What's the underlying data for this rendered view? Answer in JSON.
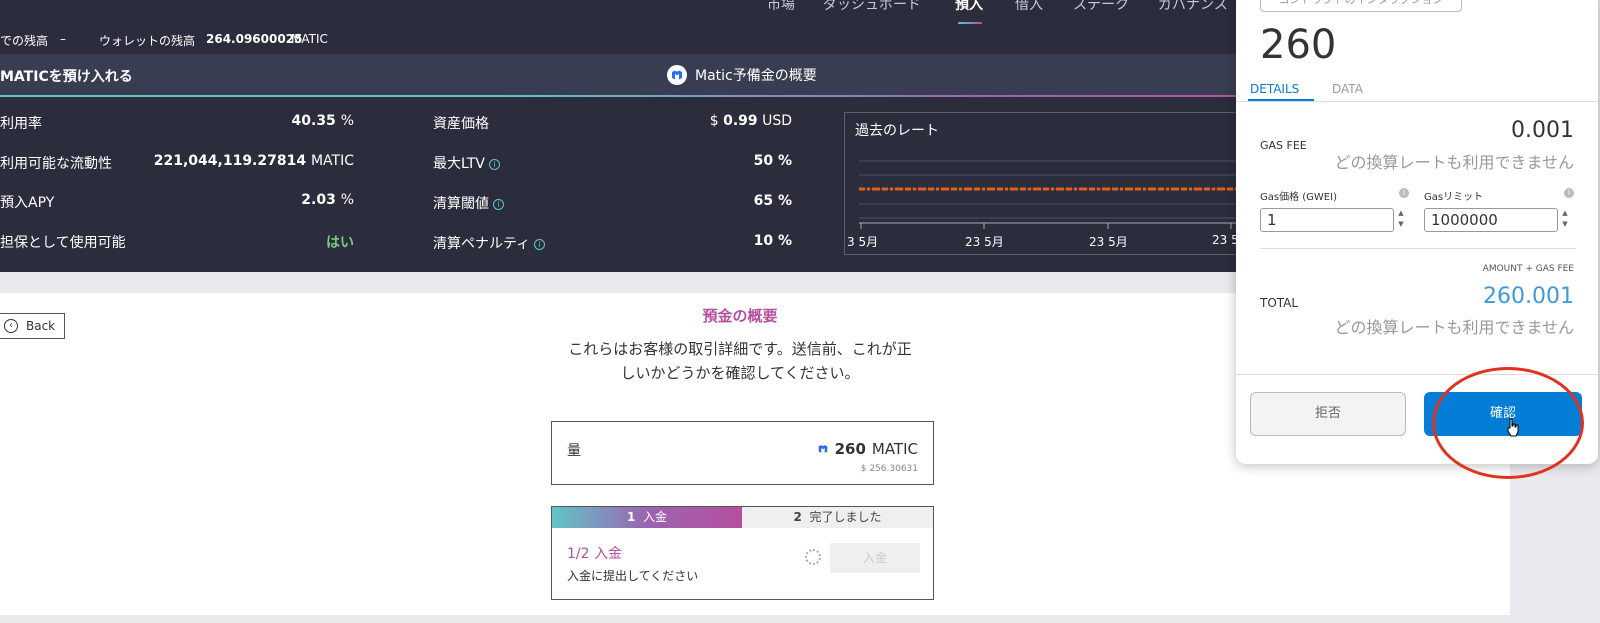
{
  "nav": {
    "items": [
      "市場",
      "ダッシュボード",
      "預入",
      "借入",
      "ステーク",
      "ガバナンス"
    ]
  },
  "balances": {
    "protocol_label": "での残高",
    "protocol_value": "–",
    "wallet_label": "ウォレットの残高",
    "wallet_value": "264.09600025",
    "wallet_unit": "MATIC"
  },
  "reserve": {
    "title": "MATICを預け入れる",
    "overview": "Matic予備金の概要"
  },
  "stats": {
    "utilization_label": "利用率",
    "utilization_value": "40.35",
    "utilization_unit": "%",
    "liquidity_label": "利用可能な流動性",
    "liquidity_value": "221,044,119.27814",
    "liquidity_unit": "MATIC",
    "apy_label": "預入APY",
    "apy_value": "2.03",
    "apy_unit": "%",
    "collateral_label": "担保として使用可能",
    "collateral_value": "はい",
    "price_label": "資産価格",
    "price_prefix": "$",
    "price_value": "0.99",
    "price_unit": "USD",
    "ltv_label": "最大LTV",
    "ltv_value": "50",
    "ltv_unit": "%",
    "threshold_label": "清算閾値",
    "threshold_value": "65",
    "threshold_unit": "%",
    "penalty_label": "清算ペナルティ",
    "penalty_value": "10",
    "penalty_unit": "%"
  },
  "rate_chart": {
    "title": "過去のレート",
    "tick_labels": [
      "3 5月",
      "23 5月",
      "23 5月",
      "23 5"
    ],
    "line_color": "#e35d16"
  },
  "main": {
    "back_label": "Back",
    "summary_title": "預金の概要",
    "summary_desc_line1": "これらはお客様の取引詳細です。送信前、これが正",
    "summary_desc_line2": "しいかどうかを確認してください。",
    "amount_label": "量",
    "amount_value": "260",
    "amount_unit": "MATIC",
    "amount_usd": "$ 256.30631",
    "step1_num": "1",
    "step1_label": "入金",
    "step2_num": "2",
    "step2_label": "完了しました",
    "step_title": "1/2 入金",
    "step_sub": "入金に提出してください",
    "deposit_button": "入金"
  },
  "wallet": {
    "contract_tag": "コントラクトのインタラクション",
    "amount": "260",
    "tab_details": "DETAILS",
    "tab_data": "DATA",
    "gas_fee_label": "GAS FEE",
    "gas_fee_value": "0.001",
    "no_rate_note": "どの換算レートも利用できません",
    "gas_price_label": "Gas価格 (GWEI)",
    "gas_price_value": "1",
    "gas_limit_label": "Gasリミット",
    "gas_limit_value": "1000000",
    "amount_gas_label": "AMOUNT + GAS FEE",
    "total_label": "TOTAL",
    "total_value": "260.001",
    "reject_button": "拒否",
    "confirm_button": "確認"
  }
}
